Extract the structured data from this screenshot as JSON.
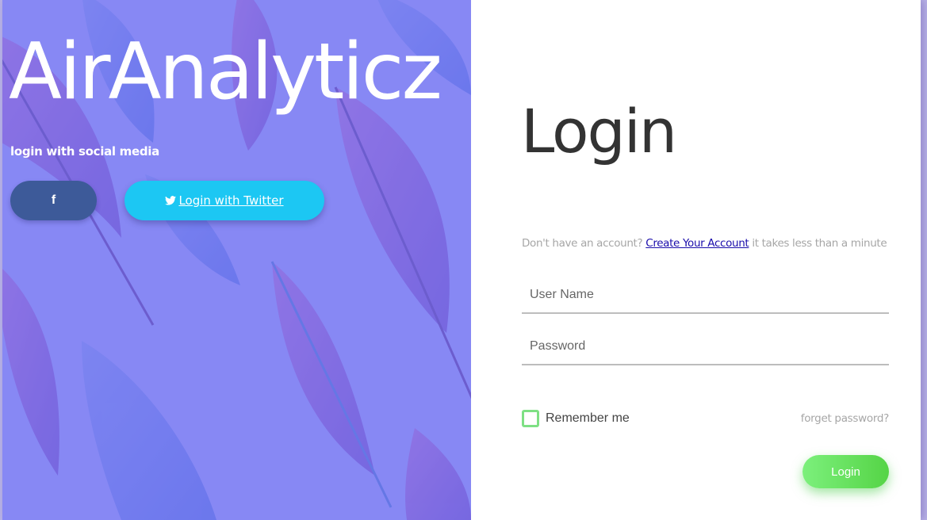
{
  "brand": {
    "name": "AirAnalyticz"
  },
  "social": {
    "caption": "login with social media",
    "facebook_icon": "f",
    "twitter_label": "Login with Twitter"
  },
  "login": {
    "title": "Login",
    "signup_prefix": "Don't have an account?",
    "signup_link": "Create Your Account",
    "signup_suffix": "it takes less than a minute",
    "username_placeholder": "User Name",
    "password_placeholder": "Password",
    "remember_label": "Remember me",
    "forgot_label": "forget password?",
    "submit_label": "Login"
  },
  "colors": {
    "panel_bg": "#8a8cf3",
    "facebook": "#3d5a99",
    "twitter": "#1cc7f3",
    "login_button": "#5fdd55",
    "checkbox_border": "#7ee084"
  }
}
